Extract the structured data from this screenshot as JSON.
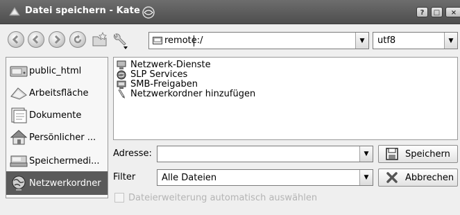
{
  "window": {
    "title": "Datei speichern - Kate",
    "buttons": {
      "help": "?",
      "maximize": "□",
      "close": "×"
    }
  },
  "toolbar": {
    "buttons": [
      {
        "name": "back-button",
        "icon": "back-arrow-icon"
      },
      {
        "name": "forward-button",
        "icon": "forward-arrow-icon"
      },
      {
        "name": "up-button",
        "icon": "up-arrow-icon"
      },
      {
        "name": "reload-button",
        "icon": "reload-icon"
      },
      {
        "name": "new-folder-button",
        "icon": "new-folder-icon"
      },
      {
        "name": "settings-button",
        "icon": "wrench-icon"
      }
    ],
    "path": {
      "value": "remote:/"
    },
    "encoding": {
      "value": "utf8"
    }
  },
  "sidebar": {
    "items": [
      {
        "label": "public_html",
        "icon": "drive-icon",
        "selected": false
      },
      {
        "label": "Arbeitsfläche",
        "icon": "desktop-icon",
        "selected": false
      },
      {
        "label": "Dokumente",
        "icon": "documents-icon",
        "selected": false
      },
      {
        "label": "Persönlicher ...",
        "icon": "home-icon",
        "selected": false
      },
      {
        "label": "Speichermedi...",
        "icon": "storage-media-icon",
        "selected": false
      },
      {
        "label": "Netzwerkordner",
        "icon": "network-folder-icon",
        "selected": true
      }
    ]
  },
  "files": [
    {
      "label": "Netzwerk-Dienste",
      "icon": "network-services-icon"
    },
    {
      "label": "SLP Services",
      "icon": "slp-services-icon"
    },
    {
      "label": "SMB-Freigaben",
      "icon": "smb-shares-icon"
    },
    {
      "label": "Netzwerkordner hinzufügen",
      "icon": "add-network-folder-icon"
    }
  ],
  "form": {
    "address_label": "Adresse:",
    "address_value": "",
    "filter_label": "Filter",
    "filter_value": "Alle Dateien",
    "save_label": "Speichern",
    "cancel_label": "Abbrechen",
    "auto_extension_label": "Dateierweiterung automatisch auswählen"
  },
  "colors": {
    "titlebar": "#5a5a5a",
    "selection": "#5a5a5a",
    "disabled_text": "#b4b4b4"
  }
}
